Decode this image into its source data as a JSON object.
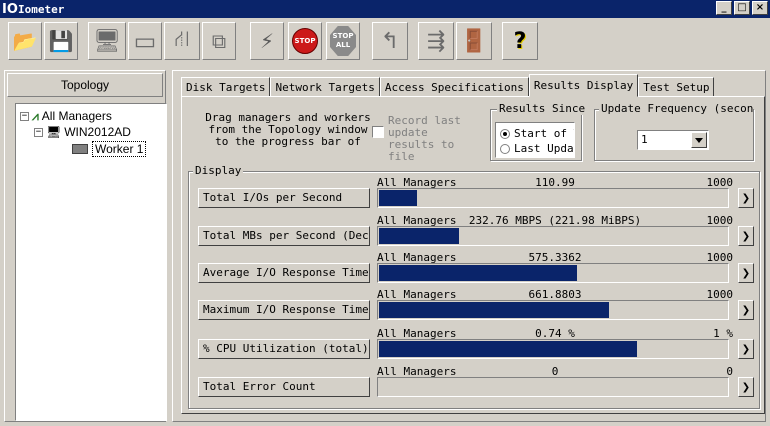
{
  "window": {
    "app_glyph": "IO",
    "title": "Iometer",
    "controls": {
      "minimize": "_",
      "maximize": "□",
      "close": "×"
    }
  },
  "toolbar": {
    "buttons": [
      {
        "icon": "open-folder-icon",
        "glyph": "📂"
      },
      {
        "icon": "save-disk-icon",
        "glyph": "💾"
      },
      {
        "icon": "new-local-worker-icon",
        "glyph": "🖥"
      },
      {
        "icon": "new-disk-worker-icon",
        "glyph": "▭"
      },
      {
        "icon": "new-network-worker-icon",
        "glyph": "⛙"
      },
      {
        "icon": "duplicate-worker-icon",
        "glyph": "⧉"
      },
      {
        "icon": "start-tests-icon",
        "glyph": "⚡"
      },
      {
        "icon": "stop-icon",
        "label": "STOP"
      },
      {
        "icon": "stop-all-icon",
        "label": "STOP ALL"
      },
      {
        "icon": "reset-workers-icon",
        "glyph": "↰"
      },
      {
        "icon": "new-manager-icon",
        "glyph": "⇶"
      },
      {
        "icon": "exit-icon",
        "glyph": "🚪"
      },
      {
        "icon": "help-icon",
        "glyph": "?"
      }
    ]
  },
  "topology": {
    "header": "Topology",
    "tree": {
      "root": {
        "label": "All Managers",
        "toggle": "−"
      },
      "manager": {
        "label": "WIN2012AD",
        "toggle": "−"
      },
      "worker": {
        "label": "Worker 1"
      }
    }
  },
  "tabs": [
    {
      "label": "Disk Targets",
      "active": false
    },
    {
      "label": "Network Targets",
      "active": false
    },
    {
      "label": "Access Specifications",
      "active": false
    },
    {
      "label": "Results Display",
      "active": true
    },
    {
      "label": "Test Setup",
      "active": false
    }
  ],
  "results": {
    "hint": "Drag managers and workers from the Topology window to the progress bar of your",
    "record_last_label": "Record last update results to file",
    "results_since": {
      "title": "Results Since",
      "options": [
        {
          "label": "Start of T",
          "selected": true
        },
        {
          "label": "Last Updat",
          "selected": false
        }
      ]
    },
    "update_frequency": {
      "title": "Update Frequency (seconds)",
      "value": "1"
    },
    "display": {
      "title": "Display",
      "rows": [
        {
          "button": "Total I/Os per Second",
          "manager": "All Managers",
          "value": "110.99",
          "max": "1000",
          "fill": 0.11
        },
        {
          "button": "Total MBs per Second (Decimal)",
          "manager": "All Managers",
          "value": "232.76 MBPS (221.98 MiBPS)",
          "max": "1000",
          "fill": 0.23
        },
        {
          "button": "Average I/O Response Time (ms)",
          "manager": "All Managers",
          "value": "575.3362",
          "max": "1000",
          "fill": 0.57
        },
        {
          "button": "Maximum I/O Response Time (ms)",
          "manager": "All Managers",
          "value": "661.8803",
          "max": "1000",
          "fill": 0.66
        },
        {
          "button": "% CPU Utilization (total)",
          "manager": "All Managers",
          "value": "0.74 %",
          "max": "1 %",
          "fill": 0.74
        },
        {
          "button": "Total Error Count",
          "manager": "All Managers",
          "value": "0",
          "max": "0",
          "fill": 0
        }
      ],
      "arrow_glyph": "❯"
    }
  },
  "colors": {
    "titlebar": "#0a246a",
    "bar_fill": "#0a246a",
    "face": "#d4d0c8",
    "stop_red": "#cc1a1a"
  }
}
